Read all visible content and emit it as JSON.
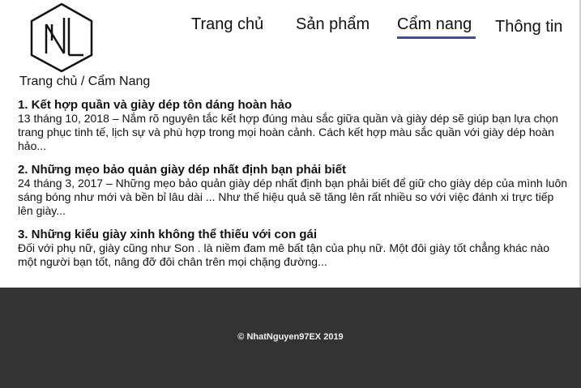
{
  "header": {
    "logo_name": "NL monogram logo",
    "breadcrumb": "Trang chủ / Cẩm Nang"
  },
  "nav": {
    "items": [
      {
        "label": "Trang chủ",
        "active": false
      },
      {
        "label": "Sản phẩm",
        "active": false
      },
      {
        "label": "Cẩm nang",
        "active": true
      },
      {
        "label": "Thông tin",
        "active": false
      }
    ],
    "active_color": "#3f4fa0"
  },
  "articles": [
    {
      "title": "1. Kết hợp quần và giày dép tôn dáng hoàn hảo",
      "body": "13 tháng 10, 2018 – Nắm rõ nguyên tắc kết hợp đúng màu sắc giữa quần và giày dép sẽ giúp bạn lựa chọn trang phục tinh tế, lịch sự và phù hợp trong mọi hoàn cảnh. Cách kết hợp màu sắc quần với giày dép hoàn hảo..."
    },
    {
      "title": "2. Những mẹo bảo quản giày dép nhất định bạn phải biết",
      "body": "24 tháng 3, 2017 – Những mẹo bảo quản giày dép nhất định bạn phải biết để giữ cho giày dép của mình luôn sáng bóng như mới và bền bỉ lâu dài ... Như thế hiệu quả sẽ tăng lên rất nhiều so với việc đánh xi trực tiếp lên giày..."
    },
    {
      "title": "3. Những kiểu giày xinh không thể thiếu với con gái",
      "body": "Đối với phụ nữ, giày cũng như Son . là niềm đam mê bất tận của phụ nữ. Một đôi giày tốt chẳng khác nào một người bạn tốt, nâng đỡ đôi chân trên mọi chặng đường..."
    }
  ],
  "footer": {
    "copyright": "© NhatNguyen97EX 2019",
    "background_color": "#333333"
  }
}
